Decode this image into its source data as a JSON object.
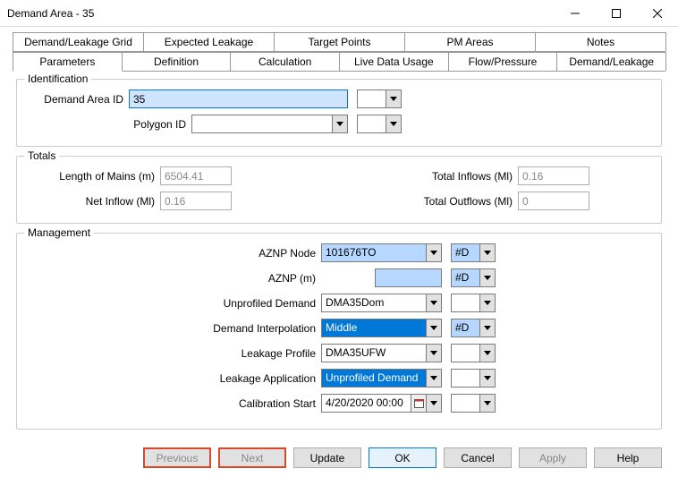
{
  "window": {
    "title": "Demand Area - 35"
  },
  "tabs_top": [
    "Demand/Leakage Grid",
    "Expected Leakage",
    "Target Points",
    "PM Areas",
    "Notes"
  ],
  "tabs_bottom": [
    "Parameters",
    "Definition",
    "Calculation",
    "Live Data Usage",
    "Flow/Pressure",
    "Demand/Leakage"
  ],
  "active_tab": "Parameters",
  "identification": {
    "legend": "Identification",
    "demand_area_id_label": "Demand Area ID",
    "demand_area_id_value": "35",
    "polygon_id_label": "Polygon ID",
    "polygon_id_value": ""
  },
  "totals": {
    "legend": "Totals",
    "length_of_mains_label": "Length of Mains (m)",
    "length_of_mains_value": "6504.41",
    "total_inflows_label": "Total Inflows (Ml)",
    "total_inflows_value": "0.16",
    "net_inflow_label": "Net Inflow (Ml)",
    "net_inflow_value": "0.16",
    "total_outflows_label": "Total Outflows (Ml)",
    "total_outflows_value": "0"
  },
  "management": {
    "legend": "Management",
    "aznp_node_label": "AZNP Node",
    "aznp_node_value": "101676TO",
    "aznp_node_flag": "#D",
    "aznp_m_label": "AZNP (m)",
    "aznp_m_value": "",
    "aznp_m_flag": "#D",
    "unprofiled_demand_label": "Unprofiled Demand",
    "unprofiled_demand_value": "DMA35Dom",
    "unprofiled_demand_flag": "",
    "demand_interpolation_label": "Demand Interpolation",
    "demand_interpolation_value": "Middle",
    "demand_interpolation_flag": "#D",
    "leakage_profile_label": "Leakage Profile",
    "leakage_profile_value": "DMA35UFW",
    "leakage_profile_flag": "",
    "leakage_application_label": "Leakage Application",
    "leakage_application_value": "Unprofiled Demand",
    "leakage_application_flag": "",
    "calibration_start_label": "Calibration Start",
    "calibration_start_value": "4/20/2020 00:00",
    "calibration_start_flag": ""
  },
  "footer": {
    "previous": "Previous",
    "next": "Next",
    "update": "Update",
    "ok": "OK",
    "cancel": "Cancel",
    "apply": "Apply",
    "help": "Help"
  }
}
